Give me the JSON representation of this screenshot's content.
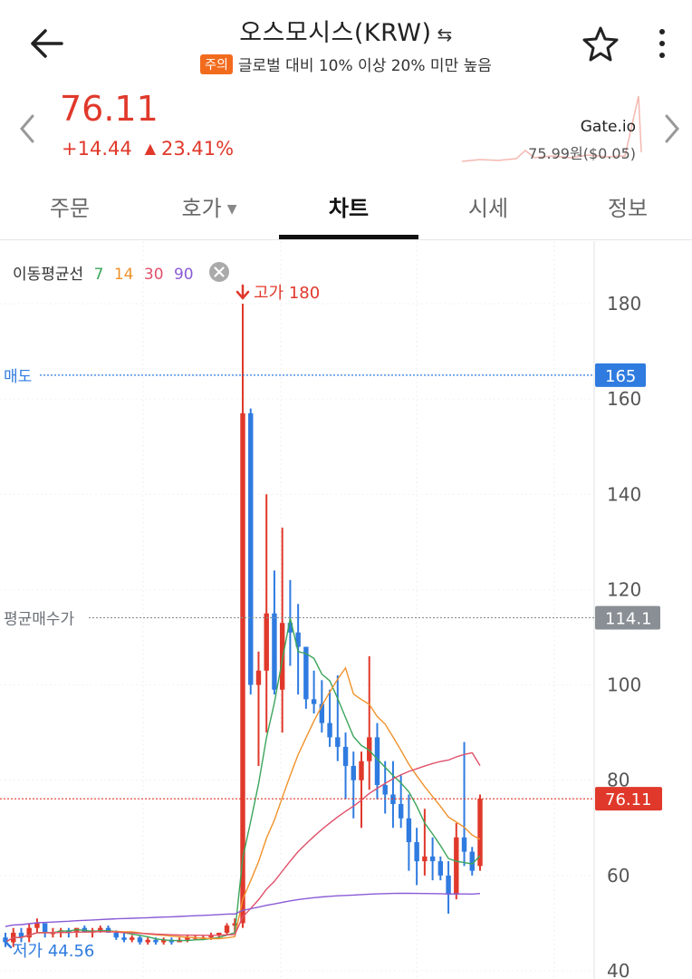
{
  "header": {
    "title": "오스모시스(KRW)",
    "warning_badge": "주의",
    "warning_text": "글로벌 대비 10% 이상 20% 미만 높음"
  },
  "price": {
    "current": "76.11",
    "change_abs": "+14.44",
    "change_pct": "23.41%",
    "exchange": "Gate.io",
    "exchange_price": "75.99원($0.05)"
  },
  "tabs": [
    "주문",
    "호가",
    "차트",
    "시세",
    "정보"
  ],
  "active_tab": "차트",
  "chart": {
    "ma_label": "이동평균선",
    "ma_periods": [
      "7",
      "14",
      "30",
      "90"
    ],
    "ma_colors": [
      "#3aa55a",
      "#f0922b",
      "#e0506a",
      "#8a5bd6"
    ],
    "high_label": "고가 180",
    "low_label": "저가 44.56",
    "sell_label": "매도",
    "sell_value": "165",
    "avg_label": "평균매수가",
    "avg_value": "114.1",
    "current_value": "76.11",
    "y_ticks": [
      "180",
      "160",
      "140",
      "120",
      "100",
      "80",
      "60",
      "40"
    ],
    "up_color": "#e0392b",
    "down_color": "#2f7be0"
  },
  "chart_data": {
    "type": "candlestick",
    "y_range": [
      40,
      190
    ],
    "candles": [
      {
        "o": 47,
        "h": 48,
        "l": 45,
        "c": 46
      },
      {
        "o": 46,
        "h": 49,
        "l": 45,
        "c": 48
      },
      {
        "o": 48,
        "h": 49,
        "l": 46,
        "c": 47
      },
      {
        "o": 47,
        "h": 50,
        "l": 46,
        "c": 49
      },
      {
        "o": 49,
        "h": 51,
        "l": 48,
        "c": 50
      },
      {
        "o": 50,
        "h": 50,
        "l": 47,
        "c": 48
      },
      {
        "o": 48,
        "h": 49,
        "l": 47,
        "c": 48
      },
      {
        "o": 48,
        "h": 49,
        "l": 47,
        "c": 48.5
      },
      {
        "o": 48.5,
        "h": 49,
        "l": 47,
        "c": 48
      },
      {
        "o": 48,
        "h": 49,
        "l": 47,
        "c": 49
      },
      {
        "o": 49,
        "h": 49.5,
        "l": 48,
        "c": 48
      },
      {
        "o": 48,
        "h": 49,
        "l": 47,
        "c": 48.5
      },
      {
        "o": 48.5,
        "h": 49.5,
        "l": 48,
        "c": 49
      },
      {
        "o": 49,
        "h": 49.5,
        "l": 48,
        "c": 48
      },
      {
        "o": 48,
        "h": 48.5,
        "l": 46.5,
        "c": 47
      },
      {
        "o": 47,
        "h": 48,
        "l": 46,
        "c": 46.5
      },
      {
        "o": 46.5,
        "h": 47.5,
        "l": 46,
        "c": 47
      },
      {
        "o": 47,
        "h": 47.5,
        "l": 45.5,
        "c": 46
      },
      {
        "o": 46,
        "h": 47,
        "l": 45.5,
        "c": 46.5
      },
      {
        "o": 46.5,
        "h": 47,
        "l": 45.5,
        "c": 46
      },
      {
        "o": 46,
        "h": 47,
        "l": 45.5,
        "c": 46.5
      },
      {
        "o": 46.5,
        "h": 47,
        "l": 45.5,
        "c": 46
      },
      {
        "o": 46,
        "h": 47,
        "l": 46,
        "c": 46.5
      },
      {
        "o": 46.5,
        "h": 47.5,
        "l": 46,
        "c": 47
      },
      {
        "o": 47,
        "h": 47.5,
        "l": 46.5,
        "c": 47
      },
      {
        "o": 47,
        "h": 47.5,
        "l": 46.5,
        "c": 47
      },
      {
        "o": 47,
        "h": 48,
        "l": 46.5,
        "c": 47.5
      },
      {
        "o": 47.5,
        "h": 48,
        "l": 47,
        "c": 48
      },
      {
        "o": 48,
        "h": 50,
        "l": 47.5,
        "c": 49.5
      },
      {
        "o": 49.5,
        "h": 51,
        "l": 48,
        "c": 50
      },
      {
        "o": 50,
        "h": 180,
        "l": 49,
        "c": 157
      },
      {
        "o": 157,
        "h": 158,
        "l": 98,
        "c": 100
      },
      {
        "o": 100,
        "h": 107,
        "l": 83,
        "c": 103
      },
      {
        "o": 103,
        "h": 140,
        "l": 90,
        "c": 115
      },
      {
        "o": 115,
        "h": 124,
        "l": 98,
        "c": 99
      },
      {
        "o": 99,
        "h": 133,
        "l": 90,
        "c": 113
      },
      {
        "o": 113,
        "h": 122,
        "l": 104,
        "c": 111
      },
      {
        "o": 111,
        "h": 117,
        "l": 98,
        "c": 108
      },
      {
        "o": 108,
        "h": 108,
        "l": 95,
        "c": 97
      },
      {
        "o": 97,
        "h": 103,
        "l": 94,
        "c": 96
      },
      {
        "o": 96,
        "h": 101,
        "l": 90,
        "c": 92
      },
      {
        "o": 92,
        "h": 99,
        "l": 87,
        "c": 89
      },
      {
        "o": 89,
        "h": 102,
        "l": 84,
        "c": 87
      },
      {
        "o": 87,
        "h": 90,
        "l": 76,
        "c": 83
      },
      {
        "o": 83,
        "h": 86,
        "l": 72,
        "c": 80
      },
      {
        "o": 80,
        "h": 86,
        "l": 70,
        "c": 84
      },
      {
        "o": 84,
        "h": 106,
        "l": 78,
        "c": 89
      },
      {
        "o": 89,
        "h": 92,
        "l": 76,
        "c": 79
      },
      {
        "o": 79,
        "h": 84,
        "l": 73,
        "c": 77
      },
      {
        "o": 77,
        "h": 84,
        "l": 70,
        "c": 75
      },
      {
        "o": 75,
        "h": 81,
        "l": 70,
        "c": 72
      },
      {
        "o": 72,
        "h": 77,
        "l": 61,
        "c": 67
      },
      {
        "o": 67,
        "h": 70,
        "l": 58,
        "c": 63
      },
      {
        "o": 63,
        "h": 74,
        "l": 60,
        "c": 64
      },
      {
        "o": 64,
        "h": 68,
        "l": 59,
        "c": 63
      },
      {
        "o": 63,
        "h": 64,
        "l": 59,
        "c": 60
      },
      {
        "o": 60,
        "h": 63,
        "l": 52,
        "c": 56
      },
      {
        "o": 56,
        "h": 71,
        "l": 55,
        "c": 68
      },
      {
        "o": 68,
        "h": 88,
        "l": 62,
        "c": 65
      },
      {
        "o": 65,
        "h": 66,
        "l": 60,
        "c": 61
      },
      {
        "o": 62,
        "h": 77,
        "l": 61,
        "c": 76.11
      }
    ]
  }
}
